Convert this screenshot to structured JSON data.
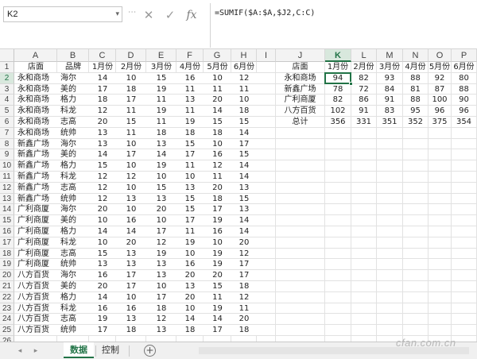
{
  "name_box": {
    "value": "K2"
  },
  "formula_bar": {
    "formula": "=SUMIF($A:$A,$J2,C:C)",
    "cancel_icon": "close-icon",
    "enter_icon": "check-icon",
    "fx_label": "fx"
  },
  "columns": [
    "A",
    "B",
    "C",
    "D",
    "E",
    "F",
    "G",
    "H",
    "I",
    "J",
    "K",
    "L",
    "M",
    "N",
    "O",
    "P"
  ],
  "selected_cell": "K2",
  "left_table": {
    "headers": [
      "店面",
      "品牌",
      "1月份",
      "2月份",
      "3月份",
      "4月份",
      "5月份",
      "6月份"
    ],
    "rows": [
      [
        "永和商场",
        "海尔",
        "14",
        "10",
        "15",
        "16",
        "10",
        "12"
      ],
      [
        "永和商场",
        "美的",
        "17",
        "18",
        "19",
        "11",
        "11",
        "11"
      ],
      [
        "永和商场",
        "格力",
        "18",
        "17",
        "11",
        "13",
        "20",
        "10"
      ],
      [
        "永和商场",
        "科龙",
        "12",
        "11",
        "19",
        "11",
        "14",
        "18"
      ],
      [
        "永和商场",
        "志高",
        "20",
        "15",
        "11",
        "19",
        "15",
        "15"
      ],
      [
        "永和商场",
        "统帅",
        "13",
        "11",
        "18",
        "18",
        "18",
        "14"
      ],
      [
        "新鑫广场",
        "海尔",
        "13",
        "10",
        "13",
        "15",
        "10",
        "17"
      ],
      [
        "新鑫广场",
        "美的",
        "14",
        "17",
        "14",
        "17",
        "16",
        "15"
      ],
      [
        "新鑫广场",
        "格力",
        "15",
        "10",
        "19",
        "11",
        "12",
        "14"
      ],
      [
        "新鑫广场",
        "科龙",
        "12",
        "12",
        "10",
        "10",
        "11",
        "14"
      ],
      [
        "新鑫广场",
        "志高",
        "12",
        "10",
        "15",
        "13",
        "20",
        "13"
      ],
      [
        "新鑫广场",
        "统帅",
        "12",
        "13",
        "13",
        "15",
        "18",
        "15"
      ],
      [
        "广利商厦",
        "海尔",
        "20",
        "10",
        "20",
        "15",
        "17",
        "13"
      ],
      [
        "广利商厦",
        "美的",
        "10",
        "16",
        "10",
        "17",
        "19",
        "14"
      ],
      [
        "广利商厦",
        "格力",
        "14",
        "14",
        "17",
        "11",
        "16",
        "14"
      ],
      [
        "广利商厦",
        "科龙",
        "10",
        "20",
        "12",
        "19",
        "10",
        "20"
      ],
      [
        "广利商厦",
        "志高",
        "15",
        "13",
        "19",
        "10",
        "19",
        "12"
      ],
      [
        "广利商厦",
        "统帅",
        "13",
        "13",
        "13",
        "16",
        "19",
        "17"
      ],
      [
        "八方百货",
        "海尔",
        "16",
        "17",
        "13",
        "20",
        "20",
        "17"
      ],
      [
        "八方百货",
        "美的",
        "20",
        "17",
        "10",
        "13",
        "15",
        "18"
      ],
      [
        "八方百货",
        "格力",
        "14",
        "10",
        "17",
        "20",
        "11",
        "12"
      ],
      [
        "八方百货",
        "科龙",
        "16",
        "16",
        "18",
        "10",
        "19",
        "11"
      ],
      [
        "八方百货",
        "志高",
        "19",
        "13",
        "12",
        "14",
        "14",
        "20"
      ],
      [
        "八方百货",
        "统帅",
        "17",
        "18",
        "13",
        "18",
        "17",
        "18"
      ]
    ]
  },
  "summary_table": {
    "headers": [
      "店面",
      "1月份",
      "2月份",
      "3月份",
      "4月份",
      "5月份",
      "6月份"
    ],
    "rows": [
      [
        "永和商场",
        "94",
        "82",
        "93",
        "88",
        "92",
        "80"
      ],
      [
        "新鑫广场",
        "78",
        "72",
        "84",
        "81",
        "87",
        "88"
      ],
      [
        "广利商厦",
        "82",
        "86",
        "91",
        "88",
        "100",
        "90"
      ],
      [
        "八方百货",
        "102",
        "91",
        "83",
        "95",
        "96",
        "96"
      ],
      [
        "总计",
        "356",
        "331",
        "351",
        "352",
        "375",
        "354"
      ]
    ]
  },
  "row_numbers": [
    "1",
    "2",
    "3",
    "4",
    "5",
    "6",
    "7",
    "8",
    "9",
    "10",
    "11",
    "12",
    "13",
    "14",
    "15",
    "16",
    "17",
    "18",
    "19",
    "20",
    "21",
    "22",
    "23",
    "24",
    "25",
    "26"
  ],
  "sheet_tabs": {
    "tabs": [
      "数据",
      "控制"
    ],
    "active": "数据",
    "add_icon": "plus-circle-icon"
  },
  "watermark": "cfan.com.cn",
  "colors": {
    "accent": "#217346",
    "header_bg": "#f3f3f3",
    "gridline": "#e2e2e2"
  }
}
